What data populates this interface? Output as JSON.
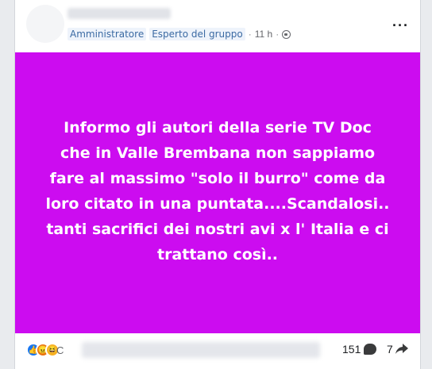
{
  "post": {
    "roles": [
      "Amministratore",
      "Esperto del gruppo"
    ],
    "time": "11 h",
    "separator": "·",
    "body_lines": [
      "Informo gli autori della serie TV Doc",
      "che in Valle Brembana non sappiamo",
      "fare al massimo \"solo il burro\" come da",
      "loro citato in una puntata....Scandalosi..",
      "tanti sacrifici dei nostri avi x l' Italia e ci",
      "trattano così.."
    ],
    "background_color": "#cc0cf0"
  },
  "footer": {
    "reaction_icons": [
      "like-icon",
      "angry-icon",
      "haha-icon"
    ],
    "reaction_prefix": "C",
    "comments": "151",
    "shares": "7"
  }
}
